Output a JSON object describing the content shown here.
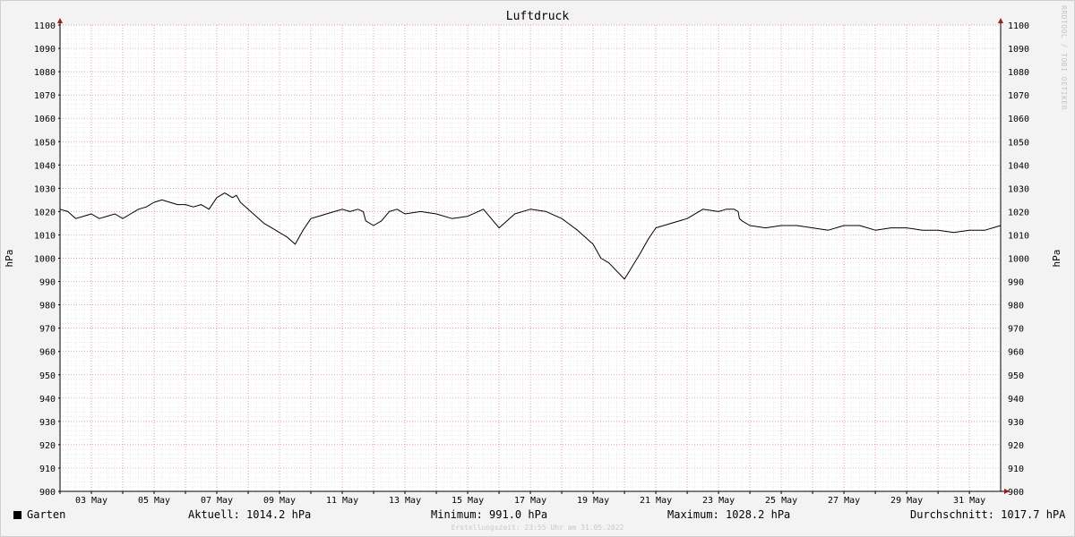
{
  "chart_data": {
    "type": "line",
    "title": "Luftdruck",
    "ylabel": "hPa",
    "ylabel_right": "hPa",
    "ylim": [
      900,
      1100
    ],
    "xlim": [
      "2022-05-02 00:00",
      "2022-05-31 23:55"
    ],
    "x_tick_labels": [
      "03 May",
      "05 May",
      "07 May",
      "09 May",
      "11 May",
      "13 May",
      "15 May",
      "17 May",
      "19 May",
      "21 May",
      "23 May",
      "25 May",
      "27 May",
      "29 May",
      "31 May"
    ],
    "y_tick_labels": [
      "900",
      "910",
      "920",
      "930",
      "940",
      "950",
      "960",
      "970",
      "980",
      "990",
      "1000",
      "1010",
      "1020",
      "1030",
      "1040",
      "1050",
      "1060",
      "1070",
      "1080",
      "1090",
      "1100"
    ],
    "grid": true,
    "line_color": "#000000",
    "grid_color": "#e08080",
    "series": [
      {
        "name": "Garten",
        "x": [
          "2022-05-02 00:00",
          "2022-05-02 06:00",
          "2022-05-02 12:00",
          "2022-05-02 18:00",
          "2022-05-03 00:00",
          "2022-05-03 06:00",
          "2022-05-03 12:00",
          "2022-05-03 18:00",
          "2022-05-04 00:00",
          "2022-05-04 06:00",
          "2022-05-04 12:00",
          "2022-05-04 18:00",
          "2022-05-05 00:00",
          "2022-05-05 06:00",
          "2022-05-05 12:00",
          "2022-05-05 18:00",
          "2022-05-06 00:00",
          "2022-05-06 06:00",
          "2022-05-06 12:00",
          "2022-05-06 18:00",
          "2022-05-07 00:00",
          "2022-05-07 06:00",
          "2022-05-07 12:00",
          "2022-05-07 15:00",
          "2022-05-07 16:00",
          "2022-05-07 18:00",
          "2022-05-08 00:00",
          "2022-05-08 06:00",
          "2022-05-08 12:00",
          "2022-05-08 18:00",
          "2022-05-09 00:00",
          "2022-05-09 06:00",
          "2022-05-09 12:00",
          "2022-05-09 18:00",
          "2022-05-10 00:00",
          "2022-05-10 06:00",
          "2022-05-10 12:00",
          "2022-05-10 18:00",
          "2022-05-11 00:00",
          "2022-05-11 06:00",
          "2022-05-11 12:00",
          "2022-05-11 16:00",
          "2022-05-11 18:00",
          "2022-05-12 00:00",
          "2022-05-12 06:00",
          "2022-05-12 12:00",
          "2022-05-12 18:00",
          "2022-05-13 00:00",
          "2022-05-13 12:00",
          "2022-05-14 00:00",
          "2022-05-14 12:00",
          "2022-05-15 00:00",
          "2022-05-15 12:00",
          "2022-05-16 00:00",
          "2022-05-16 12:00",
          "2022-05-17 00:00",
          "2022-05-17 12:00",
          "2022-05-18 00:00",
          "2022-05-18 12:00",
          "2022-05-19 00:00",
          "2022-05-19 06:00",
          "2022-05-19 12:00",
          "2022-05-20 00:00",
          "2022-05-20 12:00",
          "2022-05-20 18:00",
          "2022-05-21 00:00",
          "2022-05-21 12:00",
          "2022-05-22 00:00",
          "2022-05-22 12:00",
          "2022-05-23 00:00",
          "2022-05-23 06:00",
          "2022-05-23 12:00",
          "2022-05-23 15:00",
          "2022-05-23 16:00",
          "2022-05-23 18:00",
          "2022-05-24 00:00",
          "2022-05-24 12:00",
          "2022-05-25 00:00",
          "2022-05-25 12:00",
          "2022-05-26 00:00",
          "2022-05-26 12:00",
          "2022-05-27 00:00",
          "2022-05-27 12:00",
          "2022-05-28 00:00",
          "2022-05-28 12:00",
          "2022-05-29 00:00",
          "2022-05-29 12:00",
          "2022-05-30 00:00",
          "2022-05-30 12:00",
          "2022-05-31 00:00",
          "2022-05-31 12:00",
          "2022-05-31 23:55"
        ],
        "y": [
          1021,
          1020,
          1017,
          1018,
          1019,
          1017,
          1018,
          1019,
          1017,
          1019,
          1021,
          1022,
          1024,
          1025,
          1024,
          1023,
          1023,
          1022,
          1023,
          1021,
          1026,
          1028,
          1026,
          1027,
          1026,
          1024,
          1021,
          1018,
          1015,
          1013,
          1011,
          1009,
          1006,
          1012,
          1017,
          1018,
          1019,
          1020,
          1021,
          1020,
          1021,
          1020,
          1016,
          1014,
          1016,
          1020,
          1021,
          1019,
          1020,
          1019,
          1017,
          1018,
          1021,
          1013,
          1019,
          1021,
          1020,
          1017,
          1012,
          1006,
          1000,
          998,
          991,
          1002,
          1008,
          1013,
          1015,
          1017,
          1021,
          1020,
          1021,
          1021,
          1020,
          1017,
          1016,
          1014,
          1013,
          1014,
          1014,
          1013,
          1012,
          1014,
          1014,
          1012,
          1013,
          1013,
          1012,
          1012,
          1011,
          1012,
          1012,
          1014
        ]
      }
    ],
    "legend": {
      "series_name": "Garten",
      "swatch_color": "#000000",
      "current": "Aktuell: 1014.2 hPa",
      "minimum": "Minimum: 991.0 hPa",
      "maximum": "Maximum: 1028.2 hPa",
      "average": "Durchschnitt: 1017.7 hPA"
    },
    "footer": "Erstellungszeit: 23:55 Uhr am 31.05.2022",
    "watermark": "RRDTOOL / TOBI OETIKER"
  }
}
